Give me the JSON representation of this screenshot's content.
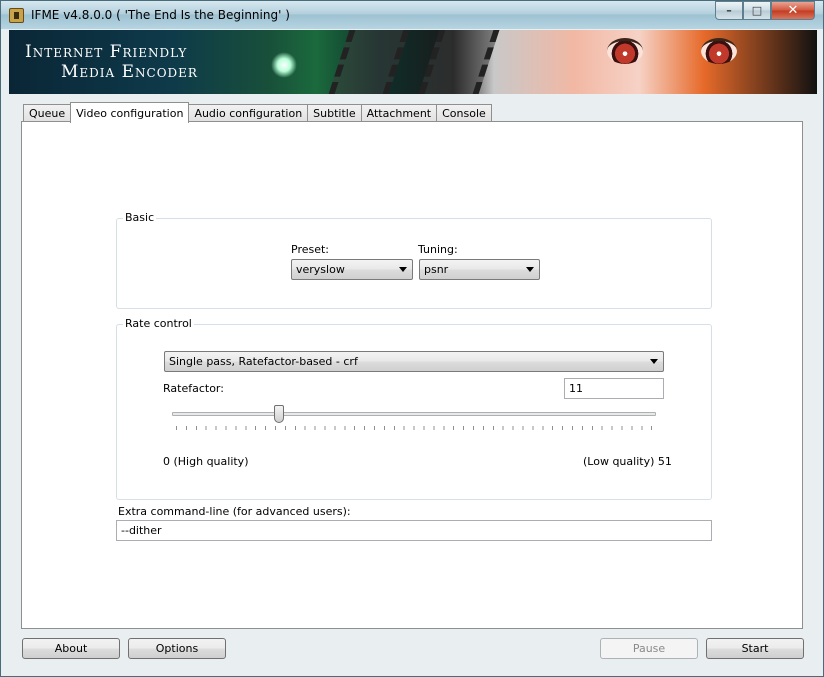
{
  "window": {
    "title": "IFME v4.8.0.0 ( 'The End Is the Beginning' )",
    "caption_minimize": "–",
    "caption_maximize": "□",
    "caption_close": "✕"
  },
  "banner": {
    "line1": "Internet Friendly",
    "line2": "Media Encoder"
  },
  "tabs": [
    {
      "label": "Queue",
      "active": false
    },
    {
      "label": "Video configuration",
      "active": true
    },
    {
      "label": "Audio configuration",
      "active": false
    },
    {
      "label": "Subtitle",
      "active": false
    },
    {
      "label": "Attachment",
      "active": false
    },
    {
      "label": "Console",
      "active": false
    }
  ],
  "basic": {
    "group_label": "Basic",
    "preset_label": "Preset:",
    "preset_value": "veryslow",
    "tuning_label": "Tuning:",
    "tuning_value": "psnr"
  },
  "rate_control": {
    "group_label": "Rate control",
    "mode_value": "Single pass, Ratefactor-based - crf",
    "ratefactor_label": "Ratefactor:",
    "ratefactor_value": "11",
    "slider_min": 0,
    "slider_max": 51,
    "slider_value": 11,
    "min_label": "0 (High quality)",
    "max_label": "(Low quality) 51"
  },
  "extra": {
    "label": "Extra command-line (for advanced users):",
    "value": "--dither"
  },
  "buttons": {
    "about": "About",
    "options": "Options",
    "pause": "Pause",
    "start": "Start"
  },
  "icons": {
    "app": "ifme-app-icon",
    "combo_arrow": "chevron-down-icon"
  }
}
